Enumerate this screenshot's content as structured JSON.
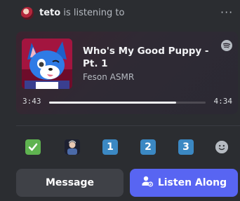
{
  "header": {
    "username": "teto",
    "status_text": "is listening to",
    "more_label": "···"
  },
  "track": {
    "title": "Who's My Good Puppy - Pt. 1",
    "artist": "Feson ASMR",
    "elapsed": "3:43",
    "duration": "4:34",
    "progress_fraction": 0.813
  },
  "reactions": [
    {
      "icon": "check-mark-emoji"
    },
    {
      "icon": "custom-avatar-emoji"
    },
    {
      "icon": "keycap-2-emoji",
      "label": "2"
    },
    {
      "icon": "keycap-3-emoji",
      "label": "3"
    },
    {
      "icon": "keycap-1-emoji",
      "label": "1"
    },
    {
      "icon": "add-reaction-icon"
    }
  ],
  "buttons": {
    "message": "Message",
    "listen_along": "Listen Along"
  },
  "colors": {
    "background": "#2b2d31",
    "card_gradient_start": "#3a2430",
    "accent": "#5865f2",
    "message_button": "#3f4147",
    "keycap": "#3b88c3",
    "check": "#5fb350"
  }
}
